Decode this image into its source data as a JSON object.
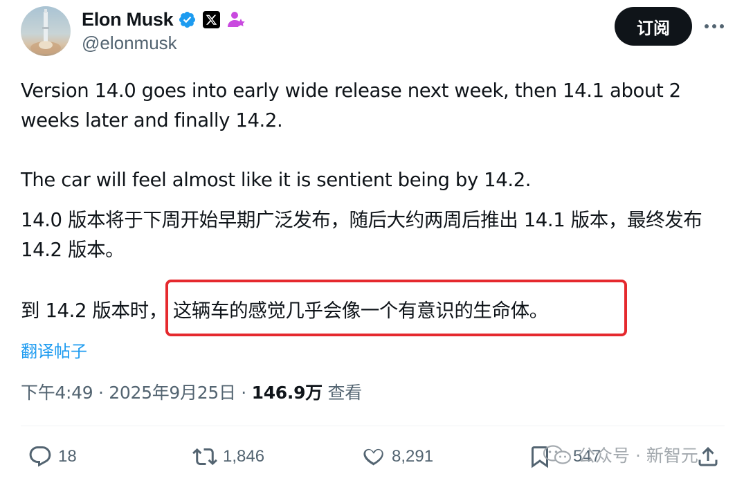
{
  "user": {
    "name": "Elon Musk",
    "handle": "@elonmusk"
  },
  "header": {
    "subscribe_label": "订阅"
  },
  "tweet": {
    "paragraph_1": "Version 14.0 goes into early wide release next week, then 14.1 about 2 weeks later and finally 14.2.",
    "paragraph_2": "The car will feel almost like it is sentient being by 14.2.",
    "translation_1": "14.0 版本将于下周开始早期广泛发布，随后大约两周后推出 14.1 版本，最终发布 14.2 版本。",
    "translation_2_prefix": "到 14.2 版本时，",
    "translation_2_highlight": "这辆车的感觉几乎会像一个有意识的生命体。",
    "translate_label": "翻译帖子"
  },
  "meta": {
    "time": "下午4:49",
    "sep": " · ",
    "date": "2025年9月25日",
    "views_count": "146.9万",
    "views_label": "查看"
  },
  "actions": {
    "replies": "18",
    "reposts": "1,846",
    "likes": "8,291",
    "bookmarks": "547"
  },
  "watermark": {
    "text": "公众号 · 新智元"
  },
  "colors": {
    "highlight_border": "#e5292e",
    "link": "#1d9bf0",
    "verified": "#1d9bf0",
    "pronoun_badge": "#c94adf"
  },
  "icons": [
    "verified-icon",
    "x-logo-icon",
    "pronoun-icon",
    "more-icon",
    "reply-icon",
    "repost-icon",
    "like-icon",
    "bookmark-icon",
    "share-icon",
    "wechat-icon"
  ]
}
